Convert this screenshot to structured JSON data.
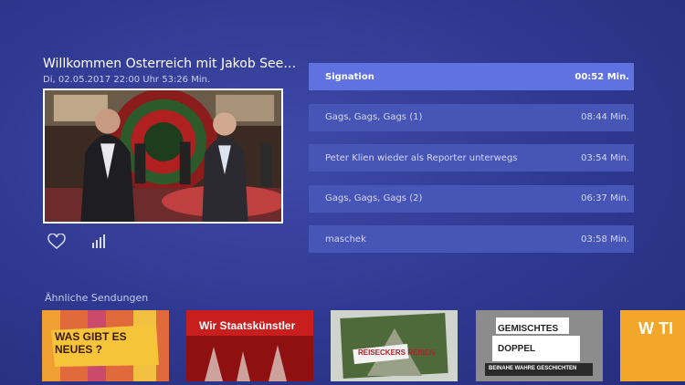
{
  "show": {
    "title": "Willkommen Österreich mit Jakob Seeböc…",
    "meta": "Di, 02.05.2017  22:00 Uhr 53:26 Min."
  },
  "actions": {
    "favorite_icon": "heart-icon",
    "quality_icon": "signal-bars-icon"
  },
  "segments": [
    {
      "title": "Signation",
      "duration": "00:52 Min.",
      "active": true
    },
    {
      "title": "Gags, Gags, Gags (1)",
      "duration": "08:44 Min.",
      "active": false
    },
    {
      "title": "Peter Klien wieder als Reporter unterwegs",
      "duration": "03:54 Min.",
      "active": false
    },
    {
      "title": "Gags, Gags, Gags (2)",
      "duration": "06:37 Min.",
      "active": false
    },
    {
      "title": "maschek",
      "duration": "03:58 Min.",
      "active": false
    }
  ],
  "similar": {
    "label": "Ähnliche Sendungen",
    "items": [
      {
        "title": "WAS GIBT ES NEUES ?"
      },
      {
        "title": "Wir Staatskünstler"
      },
      {
        "title": "REISECKERS REISEN"
      },
      {
        "title": "GEMISCHTES DOPPEL",
        "subtitle": "BEINAHE WAHRE GESCHICHTEN"
      },
      {
        "title": "W TI"
      }
    ]
  },
  "colors": {
    "background": "#2f3890",
    "segment": "#4755b6",
    "segment_active": "#5f72df"
  }
}
